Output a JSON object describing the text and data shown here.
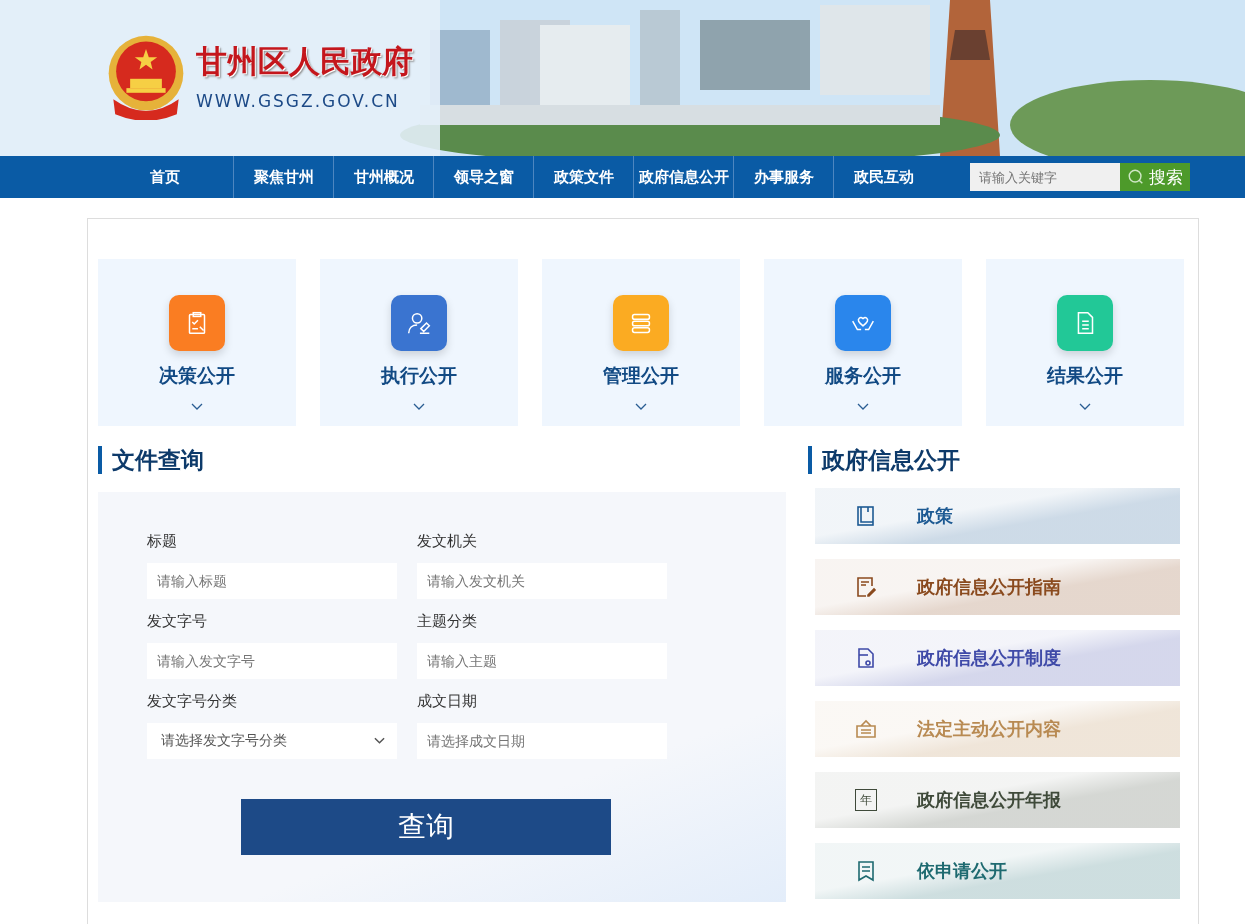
{
  "header": {
    "site_title": "甘州区人民政府",
    "site_url": "WWW.GSGZ.GOV.CN"
  },
  "nav": {
    "items": [
      {
        "label": "首页",
        "selected": false
      },
      {
        "label": "聚焦甘州",
        "selected": false
      },
      {
        "label": "甘州概况",
        "selected": false
      },
      {
        "label": "领导之窗",
        "selected": false
      },
      {
        "label": "政策文件",
        "selected": false
      },
      {
        "label": "政府信息公开",
        "selected": false
      },
      {
        "label": "办事服务",
        "selected": false
      },
      {
        "label": "政民互动",
        "selected": false
      }
    ],
    "search": {
      "placeholder": "请输入关键字",
      "button": "搜索"
    }
  },
  "categories": [
    {
      "label": "决策公开",
      "kind": "clipboard",
      "color": "#fa7d22"
    },
    {
      "label": "执行公开",
      "kind": "person",
      "color": "#3a74d0"
    },
    {
      "label": "管理公开",
      "kind": "stack",
      "color": "#fbab22"
    },
    {
      "label": "服务公开",
      "kind": "hands",
      "color": "#2a86ec"
    },
    {
      "label": "结果公开",
      "kind": "document",
      "color": "#22c897"
    }
  ],
  "file_search": {
    "title": "文件查询",
    "fields": [
      {
        "label": "标题",
        "kind": "text",
        "placeholder": "请输入标题"
      },
      {
        "label": "发文机关",
        "kind": "text",
        "placeholder": "请输入发文机关"
      },
      {
        "label": "发文字号",
        "kind": "text",
        "placeholder": "请输入发文字号"
      },
      {
        "label": "主题分类",
        "kind": "text",
        "placeholder": "请输入主题"
      },
      {
        "label": "发文字号分类",
        "kind": "select",
        "placeholder": "请选择发文字号分类"
      },
      {
        "label": "成文日期",
        "kind": "text",
        "placeholder": "请选择成文日期"
      }
    ],
    "button": "查询"
  },
  "info_disclosure": {
    "title": "政府信息公开",
    "items": [
      {
        "label": "政策",
        "kind": "book",
        "color": "#1d5a93"
      },
      {
        "label": "政府信息公开指南",
        "kind": "form",
        "color": "#8a4a1e"
      },
      {
        "label": "政府信息公开制度",
        "kind": "file",
        "color": "#3f4aa8"
      },
      {
        "label": "法定主动公开内容",
        "kind": "board",
        "color": "#b88a52"
      },
      {
        "label": "政府信息公开年报",
        "kind": "year",
        "color": "#3f4a3a",
        "icon_glyph": "年"
      },
      {
        "label": "依申请公开",
        "kind": "bookmark",
        "color": "#1e6a70"
      }
    ]
  }
}
